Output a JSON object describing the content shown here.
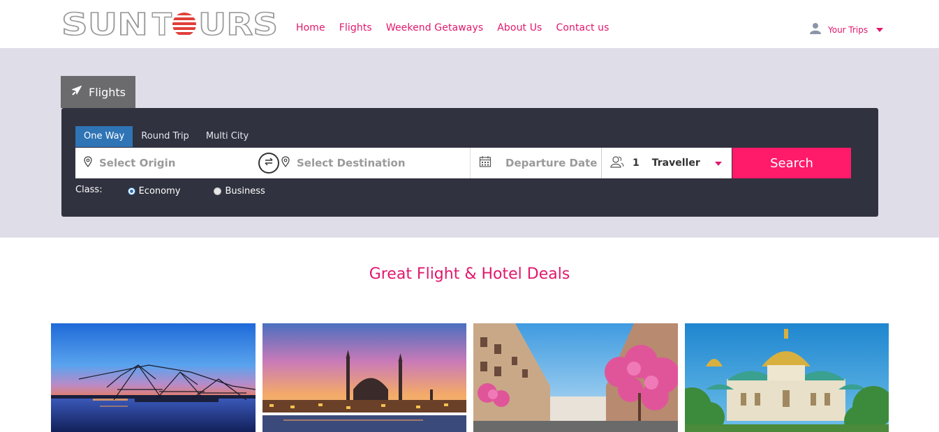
{
  "header": {
    "logo_text": "SUN TOURS",
    "nav": [
      "Home",
      "Flights",
      "Weekend Getaways",
      "About Us",
      "Contact us"
    ],
    "user_label": "Your Trips"
  },
  "search": {
    "product_tab": "Flights",
    "trip_types": [
      "One Way",
      "Round Trip",
      "Multi City"
    ],
    "active_trip_type": "One Way",
    "origin_placeholder": "Select Origin",
    "destination_placeholder": "Select Destination",
    "date_placeholder": "Departure Date",
    "traveller_count": "1",
    "traveller_label": "Traveller",
    "search_label": "Search",
    "class_label": "Class:",
    "classes": [
      "Economy",
      "Business"
    ],
    "selected_class": "Economy"
  },
  "deals": {
    "title": "Great Flight & Hotel Deals",
    "cards": [
      {
        "icon": "fishing-nets-sunset-image"
      },
      {
        "icon": "mosque-skyline-image"
      },
      {
        "icon": "blossom-street-image"
      },
      {
        "icon": "cathedral-image"
      }
    ]
  },
  "colors": {
    "accent": "#e0186c",
    "search_button": "#ff1a6a",
    "panel": "#30323f",
    "hero_bg": "#dfdde8",
    "active_tab": "#2f74b5"
  }
}
